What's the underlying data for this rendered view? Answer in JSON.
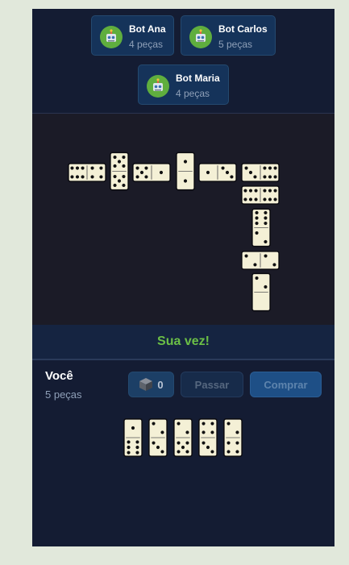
{
  "opponents": [
    {
      "name": "Bot Ana",
      "count": "4 peças"
    },
    {
      "name": "Bot Carlos",
      "count": "5 peças"
    },
    {
      "name": "Bot Maria",
      "count": "4 peças"
    }
  ],
  "board_tiles": [
    {
      "a": 6,
      "b": 4
    },
    {
      "a": 5,
      "b": 5
    },
    {
      "a": 5,
      "b": 1
    },
    {
      "a": 1,
      "b": 1
    },
    {
      "a": 1,
      "b": 3
    },
    {
      "a": 3,
      "b": 6
    },
    {
      "a": 6,
      "b": 6
    },
    {
      "a": 6,
      "b": 2
    },
    {
      "a": 2,
      "b": 2
    },
    {
      "a": 2,
      "b": 0
    }
  ],
  "status": "Sua vez!",
  "player": {
    "name": "Você",
    "count": "5 peças"
  },
  "buttons": {
    "boneyard_icon": "box-icon",
    "boneyard_count": "0",
    "pass": "Passar",
    "buy": "Comprar"
  },
  "hand": [
    {
      "a": 1,
      "b": 6
    },
    {
      "a": 2,
      "b": 3
    },
    {
      "a": 2,
      "b": 5
    },
    {
      "a": 4,
      "b": 3
    },
    {
      "a": 2,
      "b": 4
    }
  ],
  "colors": {
    "accent_green": "#6bbf46",
    "board_bg": "#1b1b27",
    "panel_bg": "#141c33",
    "tile": "#f4f0d6"
  }
}
